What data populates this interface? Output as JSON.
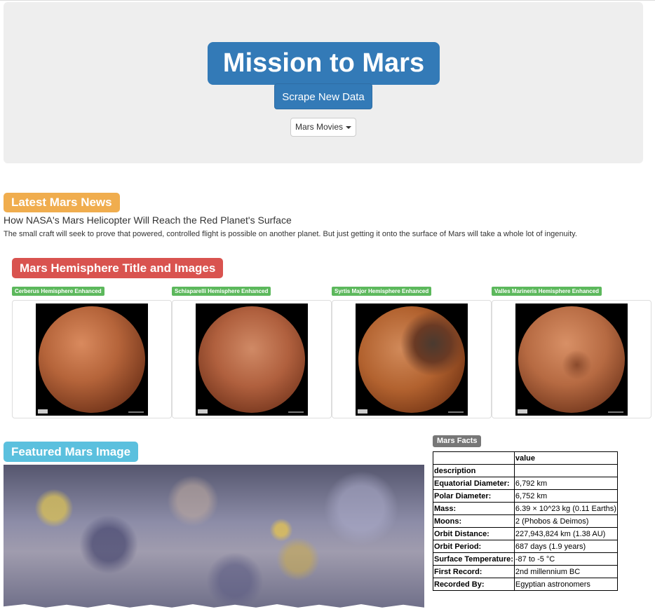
{
  "header": {
    "title": "Mission to Mars",
    "scrape_label": "Scrape New Data",
    "movies_label": "Mars Movies"
  },
  "news": {
    "section_label": "Latest Mars News",
    "title": "How NASA's Mars Helicopter Will Reach the Red Planet's Surface",
    "paragraph": "The small craft will seek to prove that powered, controlled flight is possible on another planet. But just getting it onto the surface of Mars will take a whole lot of ingenuity."
  },
  "hemispheres": {
    "section_label": "Mars Hemisphere Title and Images",
    "items": [
      {
        "title": "Cerberus Hemisphere Enhanced",
        "color": "#a0522d"
      },
      {
        "title": "Schiaparelli Hemisphere Enhanced",
        "color": "#b55e3c"
      },
      {
        "title": "Syrtis Major Hemisphere Enhanced",
        "color": "#9c4a2a"
      },
      {
        "title": "Valles Marineris Hemisphere Enhanced",
        "color": "#b25a37"
      }
    ]
  },
  "featured": {
    "section_label": "Featured Mars Image"
  },
  "facts": {
    "section_label": "Mars Facts",
    "header_value": "value",
    "header_index": "description",
    "rows": [
      {
        "key": "Equatorial Diameter:",
        "value": "6,792 km"
      },
      {
        "key": "Polar Diameter:",
        "value": "6,752 km"
      },
      {
        "key": "Mass:",
        "value": "6.39 × 10^23 kg (0.11 Earths)"
      },
      {
        "key": "Moons:",
        "value": "2 (Phobos & Deimos)"
      },
      {
        "key": "Orbit Distance:",
        "value": "227,943,824 km (1.38 AU)"
      },
      {
        "key": "Orbit Period:",
        "value": "687 days (1.9 years)"
      },
      {
        "key": "Surface Temperature:",
        "value": "-87 to -5 °C"
      },
      {
        "key": "First Record:",
        "value": "2nd millennium BC"
      },
      {
        "key": "Recorded By:",
        "value": "Egyptian astronomers"
      }
    ]
  }
}
